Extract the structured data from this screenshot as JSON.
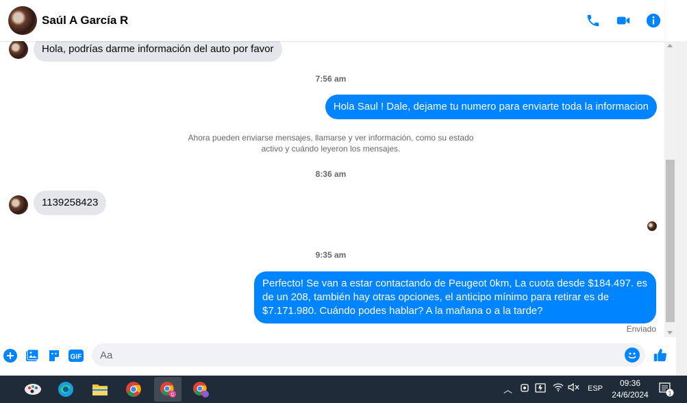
{
  "header": {
    "contact_name": "Saúl A García R",
    "icons": [
      "phone-icon",
      "video-icon",
      "info-icon"
    ],
    "accent_color": "#0084ff"
  },
  "messages": {
    "in_1": "Hola, podrías darme información del auto por favor",
    "time_1": "7:56 am",
    "out_1": "Hola Saul ! Dale, dejame tu numero para enviarte toda la informacion",
    "system_note": "Ahora pueden enviarse mensajes, llamarse y ver información, como su estado activo y cuándo leyeron los mensajes.",
    "time_2": "8:36 am",
    "in_2": "1139258423",
    "time_3": "9:35 am",
    "out_2": "Perfecto!  Se van a estar contactando de Peugeot 0km, La cuota desde $184.497. es de un 208, también hay otras opciones, el anticipo mínimo para retirar es de $7.171.980. Cuándo podes hablar? A la mañana o a la tarde?",
    "status": "Enviado"
  },
  "composer": {
    "placeholder": "Aa",
    "icons": [
      "plus-icon",
      "image-icon",
      "sticker-icon",
      "gif-icon",
      "emoji-icon",
      "like-icon"
    ],
    "gif_label": "GIF"
  },
  "taskbar": {
    "apps": [
      "paint-app-icon",
      "edge-icon",
      "file-explorer-icon",
      "chrome-icon",
      "chrome-profile-icon",
      "chrome-profile-2-icon"
    ],
    "language": "ESP",
    "time": "09:36",
    "date": "24/6/2024",
    "notification_count": "1"
  }
}
